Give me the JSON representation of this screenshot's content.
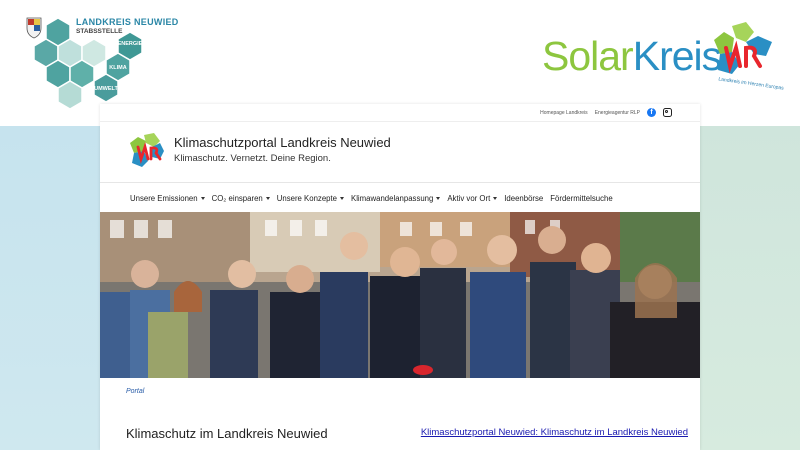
{
  "slide": {
    "logo_title": "LANDKREIS NEUWIED",
    "logo_subtitle": "STABSSTELLE",
    "hex_labels": [
      "ENERGIE",
      "KLIMA",
      "UMWELT"
    ],
    "solar_part1": "Solar",
    "solar_part2": "Kreis",
    "solar_tagline": "Landkreis im Herzen Europas",
    "colors": {
      "solar_green": "#8dc63f",
      "solar_blue": "#2a8fc4",
      "hex_teal": "#4fa3a0"
    }
  },
  "site": {
    "toplinks": [
      "Homepage Landkreis",
      "Energieagentur RLP"
    ],
    "social_icons": [
      "facebook-icon",
      "instagram-icon"
    ],
    "title": "Klimaschutzportal Landkreis Neuwied",
    "tagline": "Klimaschutz. Vernetzt. Deine Region.",
    "nav": [
      {
        "label": "Unsere Emissionen",
        "dropdown": true
      },
      {
        "label": "CO₂ einsparen",
        "dropdown": true
      },
      {
        "label": "Unsere Konzepte",
        "dropdown": true
      },
      {
        "label": "Klimawandelanpassung",
        "dropdown": true
      },
      {
        "label": "Aktiv vor Ort",
        "dropdown": true
      },
      {
        "label": "Ideenbörse",
        "dropdown": false
      },
      {
        "label": "Fördermittelsuche",
        "dropdown": false
      }
    ],
    "breadcrumb": "Portal",
    "heading": "Klimaschutz im Landkreis Neuwied",
    "link": "Klimaschutzportal Neuwied: Klimaschutz im Landkreis Neuwied"
  }
}
